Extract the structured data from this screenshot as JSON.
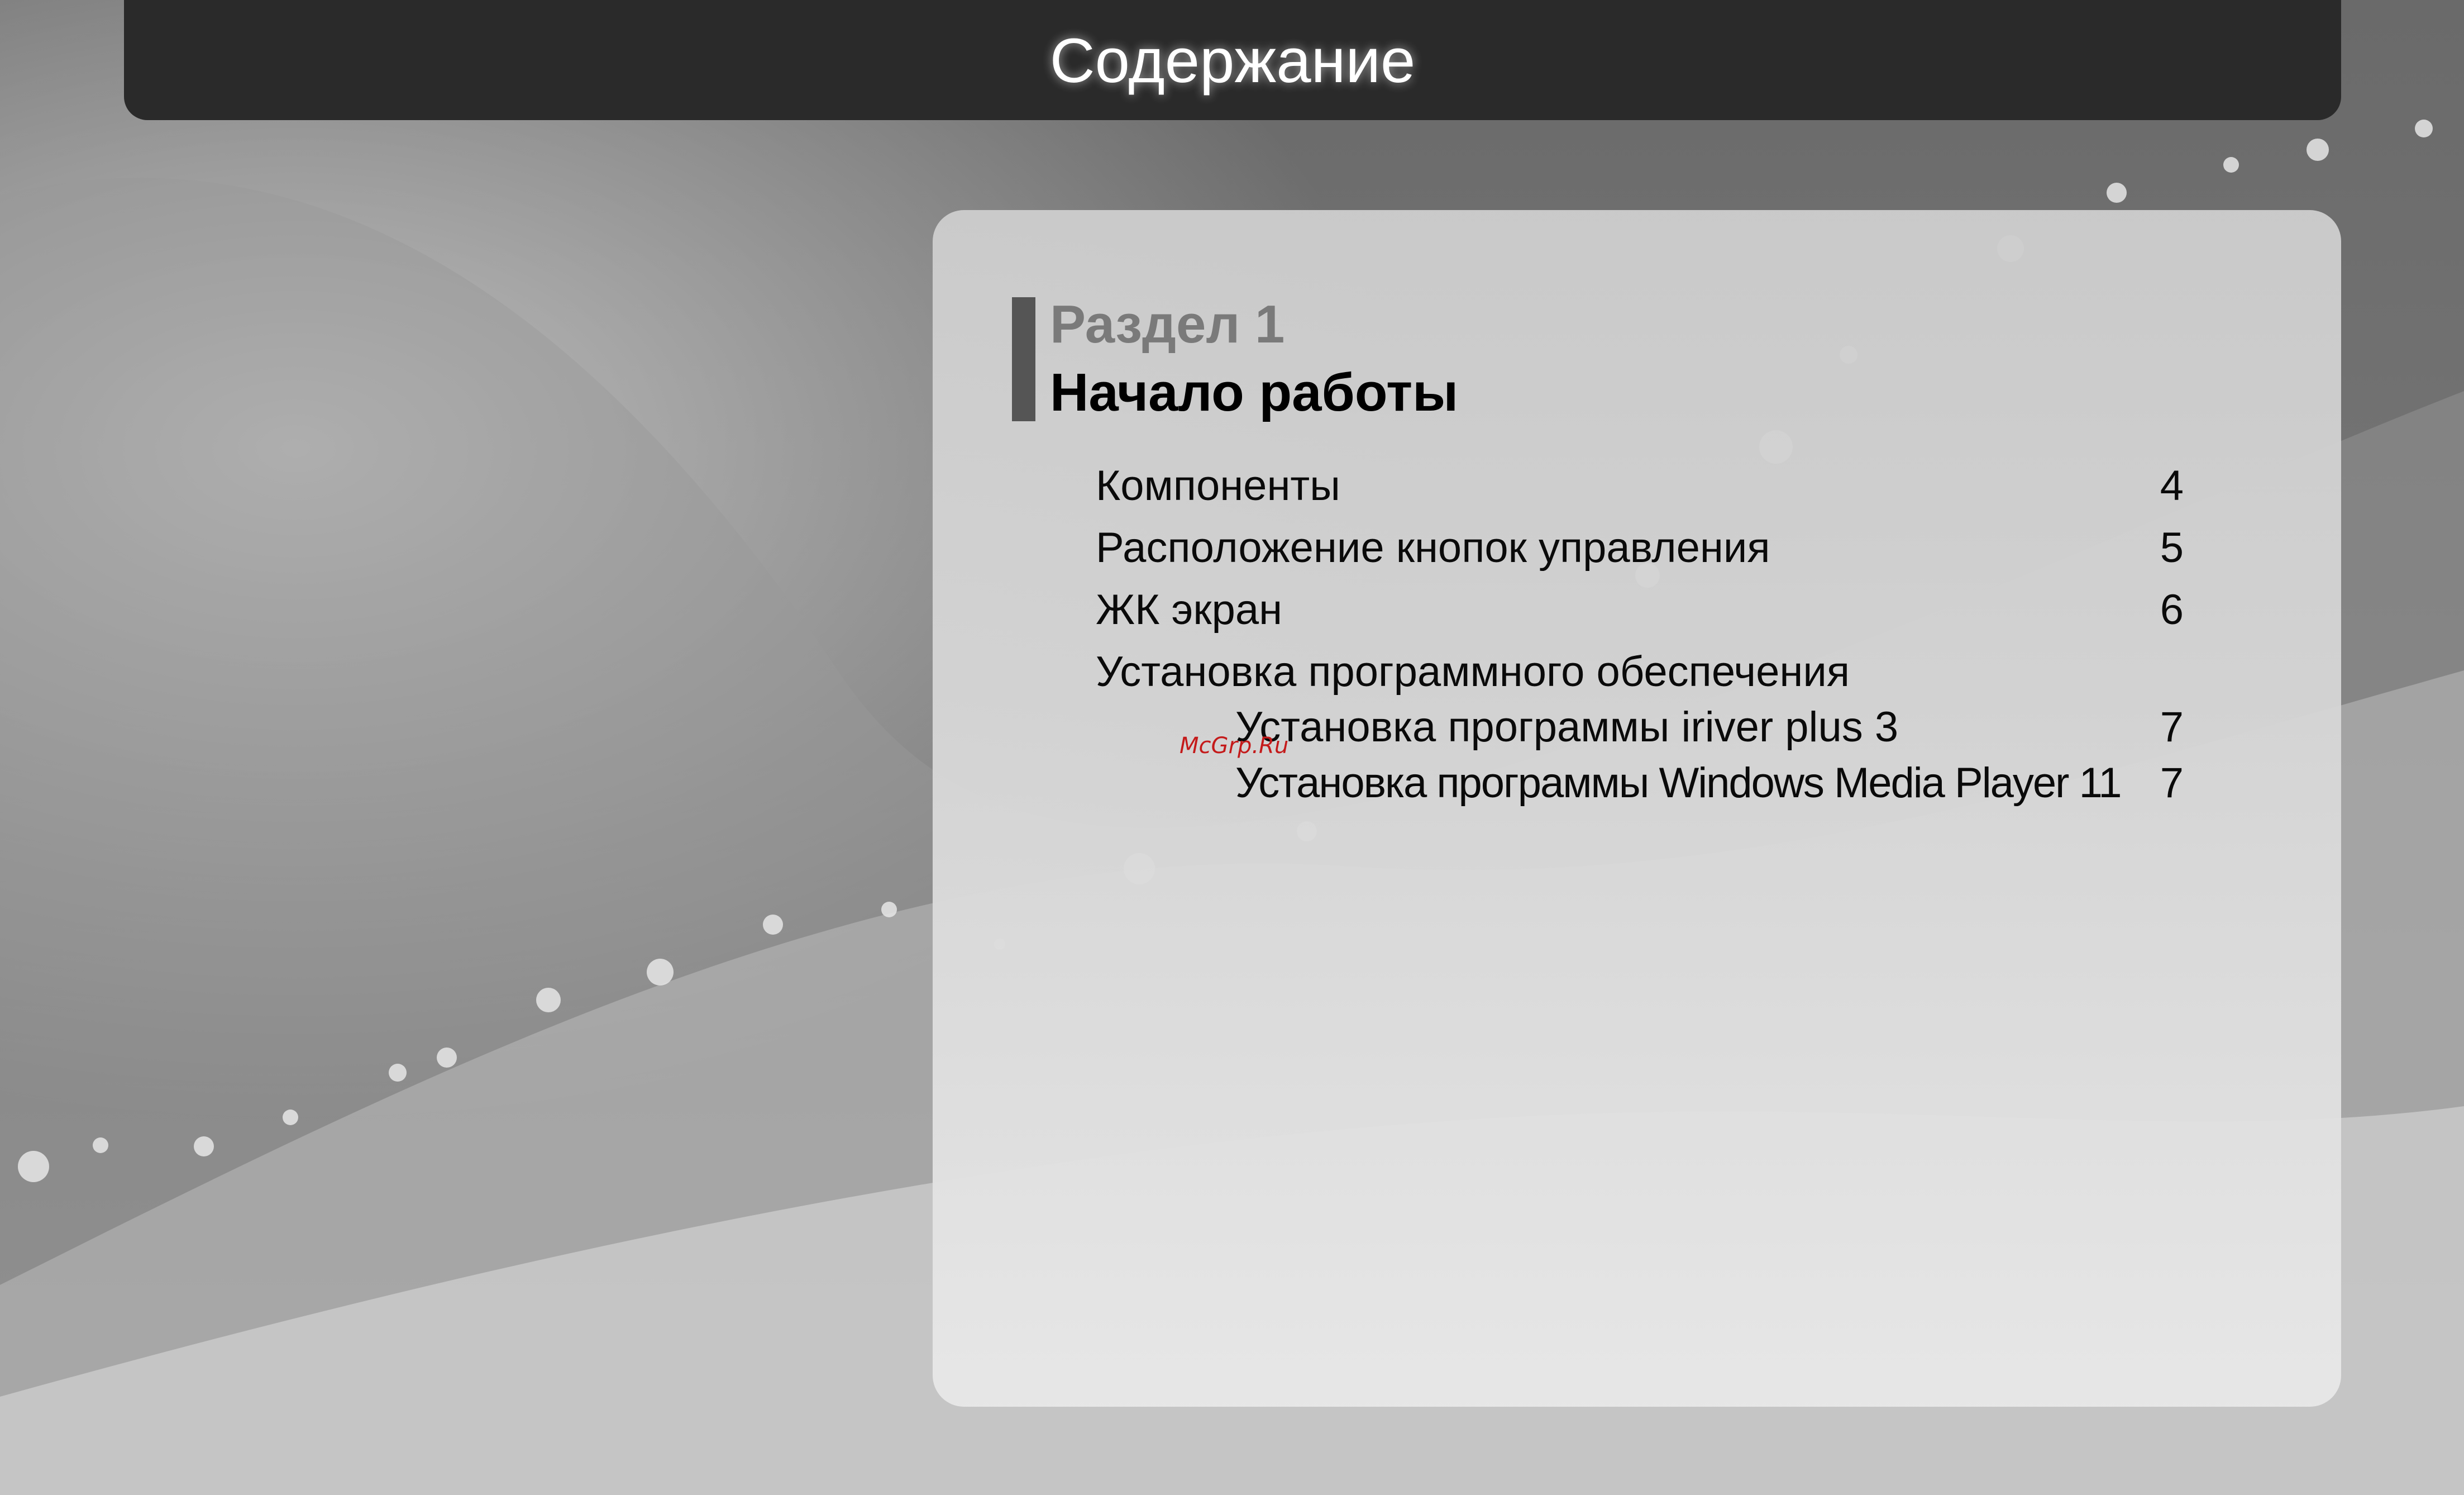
{
  "header": {
    "title": "Содержание"
  },
  "section": {
    "number": "Раздел 1",
    "title": "Начало работы"
  },
  "toc": {
    "items": [
      {
        "label": "Компоненты",
        "page": "4"
      },
      {
        "label": "Расположение кнопок управления",
        "page": "5"
      },
      {
        "label": "ЖК экран",
        "page": "6"
      },
      {
        "label": "Установка программного обеспечения",
        "page": ""
      },
      {
        "label": "Установка программы iriver plus 3",
        "page": "7"
      },
      {
        "label": "Установка программы Windows Media Player 11",
        "page": "7"
      }
    ]
  },
  "watermark": "McGrp.Ru",
  "colors": {
    "header": "#2a2a2a",
    "panel": "#d2d2d2",
    "background": "#707070",
    "section_bar": "#555555"
  }
}
